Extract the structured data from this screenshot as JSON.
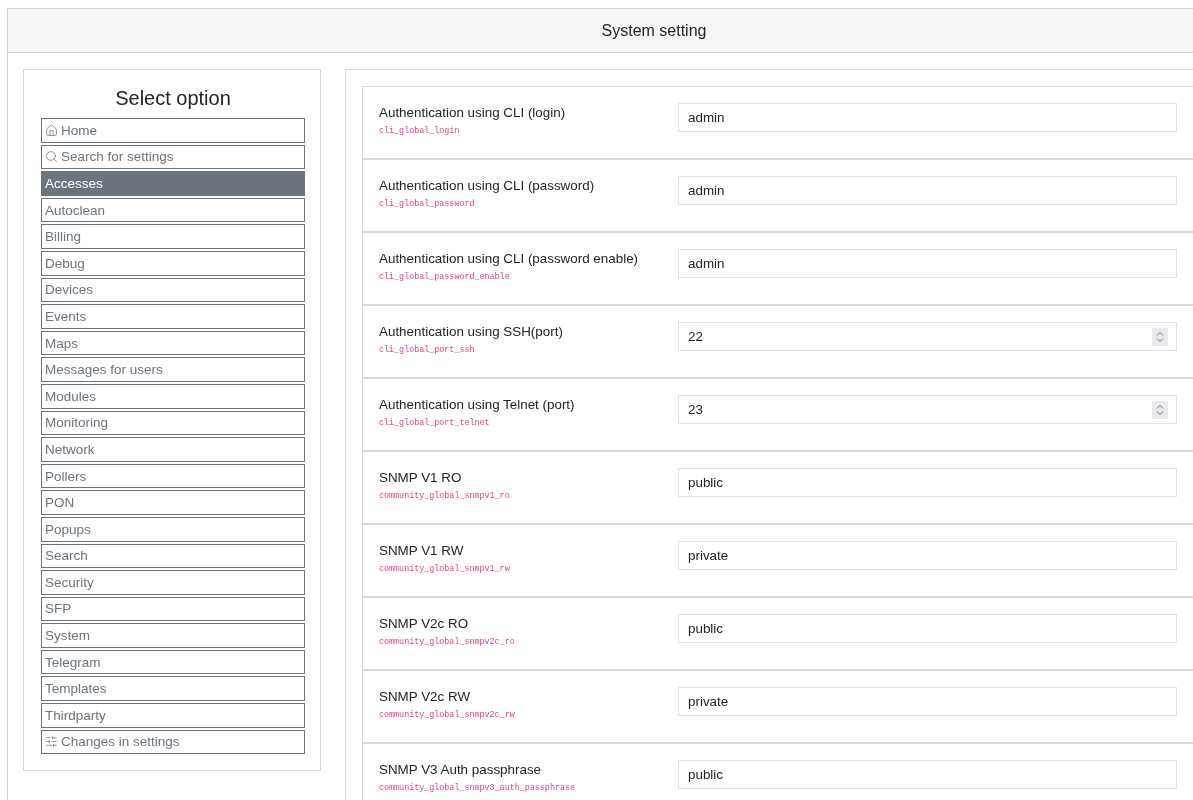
{
  "page": {
    "title": "System setting"
  },
  "sidebar": {
    "title": "Select option",
    "items": [
      {
        "label": "Home",
        "kind": "home",
        "selected": false
      },
      {
        "label": "Search for settings",
        "kind": "search",
        "selected": false
      },
      {
        "label": "Accesses",
        "kind": "section",
        "selected": true
      },
      {
        "label": "Autoclean",
        "kind": "section",
        "selected": false
      },
      {
        "label": "Billing",
        "kind": "section",
        "selected": false
      },
      {
        "label": "Debug",
        "kind": "section",
        "selected": false
      },
      {
        "label": "Devices",
        "kind": "section",
        "selected": false
      },
      {
        "label": "Events",
        "kind": "section",
        "selected": false
      },
      {
        "label": "Maps",
        "kind": "section",
        "selected": false
      },
      {
        "label": "Messages for users",
        "kind": "section",
        "selected": false
      },
      {
        "label": "Modules",
        "kind": "section",
        "selected": false
      },
      {
        "label": "Monitoring",
        "kind": "section",
        "selected": false
      },
      {
        "label": "Network",
        "kind": "section",
        "selected": false
      },
      {
        "label": "Pollers",
        "kind": "section",
        "selected": false
      },
      {
        "label": "PON",
        "kind": "section",
        "selected": false
      },
      {
        "label": "Popups",
        "kind": "section",
        "selected": false
      },
      {
        "label": "Search",
        "kind": "section",
        "selected": false
      },
      {
        "label": "Security",
        "kind": "section",
        "selected": false
      },
      {
        "label": "SFP",
        "kind": "section",
        "selected": false
      },
      {
        "label": "System",
        "kind": "section",
        "selected": false
      },
      {
        "label": "Telegram",
        "kind": "section",
        "selected": false
      },
      {
        "label": "Templates",
        "kind": "section",
        "selected": false
      },
      {
        "label": "Thirdparty",
        "kind": "section",
        "selected": false
      },
      {
        "label": "Changes in settings",
        "kind": "changes",
        "selected": false
      }
    ]
  },
  "settings": [
    {
      "label": "Authentication using CLI (login)",
      "key": "cli_global_login",
      "kind": "text",
      "value": "admin"
    },
    {
      "label": "Authentication using CLI (password)",
      "key": "cli_global_password",
      "kind": "text",
      "value": "admin"
    },
    {
      "label": "Authentication using CLI (password enable)",
      "key": "cli_global_password_enable",
      "kind": "text",
      "value": "admin"
    },
    {
      "label": "Authentication using SSH(port)",
      "key": "cli_global_port_ssh",
      "kind": "number",
      "value": "22"
    },
    {
      "label": "Authentication using Telnet (port)",
      "key": "cli_global_port_telnet",
      "kind": "number",
      "value": "23"
    },
    {
      "label": "SNMP V1 RO",
      "key": "community_global_snmpv1_ro",
      "kind": "text",
      "value": "public"
    },
    {
      "label": "SNMP V1 RW",
      "key": "community_global_snmpv1_rw",
      "kind": "text",
      "value": "private"
    },
    {
      "label": "SNMP V2c RO",
      "key": "community_global_snmpv2c_ro",
      "kind": "text",
      "value": "public"
    },
    {
      "label": "SNMP V2c RW",
      "key": "community_global_snmpv2c_rw",
      "kind": "text",
      "value": "private"
    },
    {
      "label": "SNMP V3 Auth passphrase",
      "key": "community_global_snmpv3_auth_passphrase",
      "kind": "text",
      "value": "public"
    }
  ]
}
